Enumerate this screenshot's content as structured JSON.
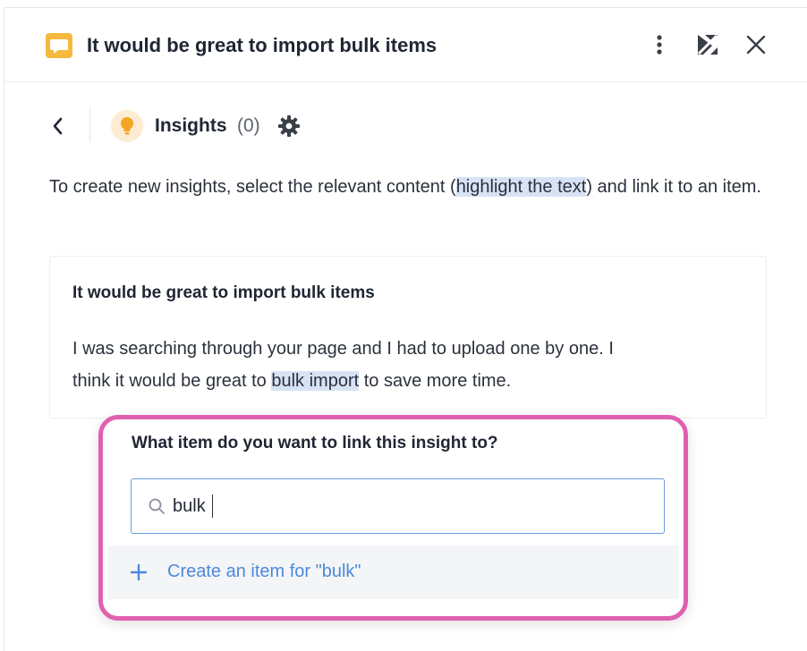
{
  "header": {
    "title": "It would be great to import bulk items",
    "icons": [
      "chat-bubble-icon",
      "more-vertical-icon",
      "expand-icon",
      "close-icon"
    ],
    "accent_color": "#f5b93e"
  },
  "toolbar": {
    "section_label": "Insights",
    "count": "(0)",
    "icons": [
      "chevron-left-icon",
      "lightbulb-icon",
      "gear-icon"
    ]
  },
  "intro": {
    "before": "To create new insights, select the relevant content (",
    "highlight": "highlight the text",
    "after": ") and link it to an item."
  },
  "card": {
    "title": "It would be great to import bulk items",
    "body_before": "I was searching through your page and I had to upload one by one. I think it would be great to ",
    "body_highlight": "bulk import",
    "body_after": " to save more time."
  },
  "popup": {
    "question": "What item do you want to link this insight to?",
    "search_value": "bulk",
    "create_label": "Create an item for \"bulk\"",
    "border_color": "#e060b0",
    "link_color": "#4a89dc"
  }
}
